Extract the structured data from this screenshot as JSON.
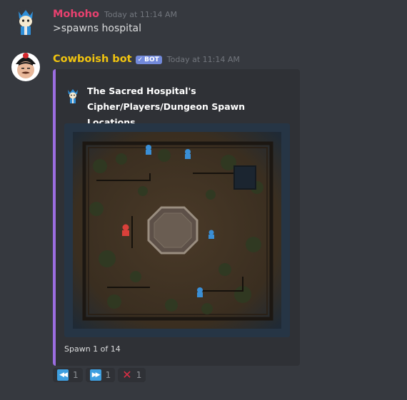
{
  "messages": [
    {
      "author": "Mohoho",
      "author_color": "#e8416f",
      "timestamp": "Today at 11:14 AM",
      "content": ">spawns hospital"
    },
    {
      "author": "Cowboish bot",
      "author_color": "#f1c40f",
      "bot_tag": "BOT",
      "bot_check": "✓",
      "timestamp": "Today at 11:14 AM",
      "embed": {
        "accent_color": "#9b6de0",
        "title_line1": "The Sacred Hospital's",
        "title_line2": "Cipher/Players/Dungeon Spawn Locations",
        "footer": "Spawn 1 of 14"
      },
      "reactions": [
        {
          "icon": "rewind-icon",
          "glyph": "◀◀",
          "count": "1"
        },
        {
          "icon": "fast-forward-icon",
          "glyph": "▶▶",
          "count": "1"
        },
        {
          "icon": "cross-mark-icon",
          "glyph": "✕",
          "count": "1"
        }
      ]
    }
  ]
}
